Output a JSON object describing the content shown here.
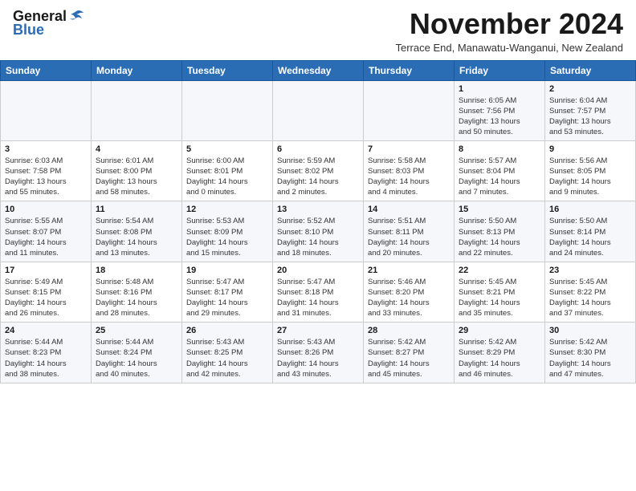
{
  "header": {
    "logo_general": "General",
    "logo_blue": "Blue",
    "month_title": "November 2024",
    "subtitle": "Terrace End, Manawatu-Wanganui, New Zealand"
  },
  "days_of_week": [
    "Sunday",
    "Monday",
    "Tuesday",
    "Wednesday",
    "Thursday",
    "Friday",
    "Saturday"
  ],
  "weeks": [
    [
      {
        "day": "",
        "info": ""
      },
      {
        "day": "",
        "info": ""
      },
      {
        "day": "",
        "info": ""
      },
      {
        "day": "",
        "info": ""
      },
      {
        "day": "",
        "info": ""
      },
      {
        "day": "1",
        "info": "Sunrise: 6:05 AM\nSunset: 7:56 PM\nDaylight: 13 hours\nand 50 minutes."
      },
      {
        "day": "2",
        "info": "Sunrise: 6:04 AM\nSunset: 7:57 PM\nDaylight: 13 hours\nand 53 minutes."
      }
    ],
    [
      {
        "day": "3",
        "info": "Sunrise: 6:03 AM\nSunset: 7:58 PM\nDaylight: 13 hours\nand 55 minutes."
      },
      {
        "day": "4",
        "info": "Sunrise: 6:01 AM\nSunset: 8:00 PM\nDaylight: 13 hours\nand 58 minutes."
      },
      {
        "day": "5",
        "info": "Sunrise: 6:00 AM\nSunset: 8:01 PM\nDaylight: 14 hours\nand 0 minutes."
      },
      {
        "day": "6",
        "info": "Sunrise: 5:59 AM\nSunset: 8:02 PM\nDaylight: 14 hours\nand 2 minutes."
      },
      {
        "day": "7",
        "info": "Sunrise: 5:58 AM\nSunset: 8:03 PM\nDaylight: 14 hours\nand 4 minutes."
      },
      {
        "day": "8",
        "info": "Sunrise: 5:57 AM\nSunset: 8:04 PM\nDaylight: 14 hours\nand 7 minutes."
      },
      {
        "day": "9",
        "info": "Sunrise: 5:56 AM\nSunset: 8:05 PM\nDaylight: 14 hours\nand 9 minutes."
      }
    ],
    [
      {
        "day": "10",
        "info": "Sunrise: 5:55 AM\nSunset: 8:07 PM\nDaylight: 14 hours\nand 11 minutes."
      },
      {
        "day": "11",
        "info": "Sunrise: 5:54 AM\nSunset: 8:08 PM\nDaylight: 14 hours\nand 13 minutes."
      },
      {
        "day": "12",
        "info": "Sunrise: 5:53 AM\nSunset: 8:09 PM\nDaylight: 14 hours\nand 15 minutes."
      },
      {
        "day": "13",
        "info": "Sunrise: 5:52 AM\nSunset: 8:10 PM\nDaylight: 14 hours\nand 18 minutes."
      },
      {
        "day": "14",
        "info": "Sunrise: 5:51 AM\nSunset: 8:11 PM\nDaylight: 14 hours\nand 20 minutes."
      },
      {
        "day": "15",
        "info": "Sunrise: 5:50 AM\nSunset: 8:13 PM\nDaylight: 14 hours\nand 22 minutes."
      },
      {
        "day": "16",
        "info": "Sunrise: 5:50 AM\nSunset: 8:14 PM\nDaylight: 14 hours\nand 24 minutes."
      }
    ],
    [
      {
        "day": "17",
        "info": "Sunrise: 5:49 AM\nSunset: 8:15 PM\nDaylight: 14 hours\nand 26 minutes."
      },
      {
        "day": "18",
        "info": "Sunrise: 5:48 AM\nSunset: 8:16 PM\nDaylight: 14 hours\nand 28 minutes."
      },
      {
        "day": "19",
        "info": "Sunrise: 5:47 AM\nSunset: 8:17 PM\nDaylight: 14 hours\nand 29 minutes."
      },
      {
        "day": "20",
        "info": "Sunrise: 5:47 AM\nSunset: 8:18 PM\nDaylight: 14 hours\nand 31 minutes."
      },
      {
        "day": "21",
        "info": "Sunrise: 5:46 AM\nSunset: 8:20 PM\nDaylight: 14 hours\nand 33 minutes."
      },
      {
        "day": "22",
        "info": "Sunrise: 5:45 AM\nSunset: 8:21 PM\nDaylight: 14 hours\nand 35 minutes."
      },
      {
        "day": "23",
        "info": "Sunrise: 5:45 AM\nSunset: 8:22 PM\nDaylight: 14 hours\nand 37 minutes."
      }
    ],
    [
      {
        "day": "24",
        "info": "Sunrise: 5:44 AM\nSunset: 8:23 PM\nDaylight: 14 hours\nand 38 minutes."
      },
      {
        "day": "25",
        "info": "Sunrise: 5:44 AM\nSunset: 8:24 PM\nDaylight: 14 hours\nand 40 minutes."
      },
      {
        "day": "26",
        "info": "Sunrise: 5:43 AM\nSunset: 8:25 PM\nDaylight: 14 hours\nand 42 minutes."
      },
      {
        "day": "27",
        "info": "Sunrise: 5:43 AM\nSunset: 8:26 PM\nDaylight: 14 hours\nand 43 minutes."
      },
      {
        "day": "28",
        "info": "Sunrise: 5:42 AM\nSunset: 8:27 PM\nDaylight: 14 hours\nand 45 minutes."
      },
      {
        "day": "29",
        "info": "Sunrise: 5:42 AM\nSunset: 8:29 PM\nDaylight: 14 hours\nand 46 minutes."
      },
      {
        "day": "30",
        "info": "Sunrise: 5:42 AM\nSunset: 8:30 PM\nDaylight: 14 hours\nand 47 minutes."
      }
    ]
  ]
}
